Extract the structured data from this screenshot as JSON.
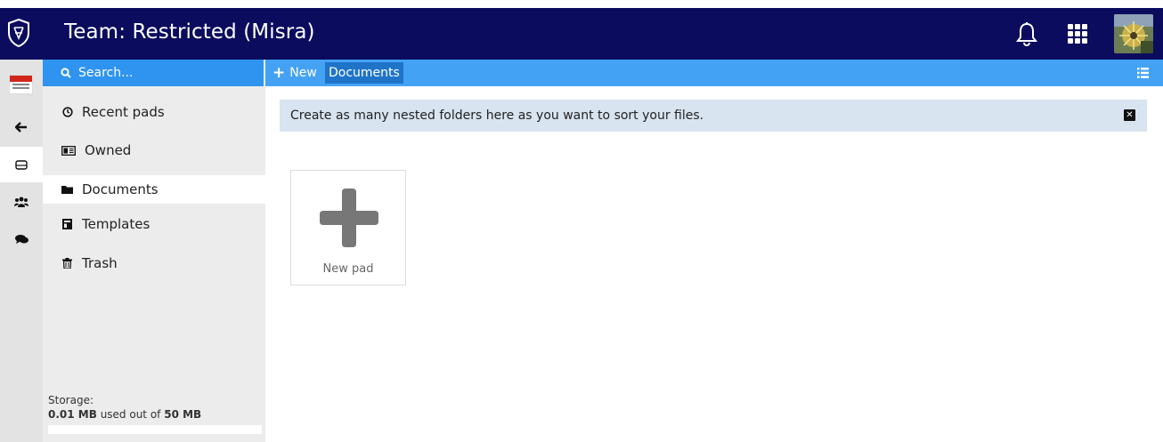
{
  "header": {
    "title": "Team: Restricted (Misra)",
    "logo_icon": "shield-logo-icon",
    "notification_icon": "bell-icon",
    "apps_icon": "grid-icon",
    "avatar_icon": "user-avatar"
  },
  "rail": {
    "items": [
      "restricted-badge-icon",
      "back-arrow-icon",
      "drive-icon",
      "members-icon",
      "chat-icon"
    ]
  },
  "sidebar": {
    "search_placeholder": "Search...",
    "items": [
      {
        "label": "Recent pads",
        "icon": "clock-icon"
      },
      {
        "label": "Owned",
        "icon": "id-card-icon"
      },
      {
        "label": "Documents",
        "icon": "folder-icon",
        "active": true
      },
      {
        "label": "Templates",
        "icon": "template-icon"
      },
      {
        "label": "Trash",
        "icon": "trash-icon"
      }
    ],
    "storage": {
      "heading": "Storage:",
      "used": "0.01 MB",
      "mid": " used out of ",
      "total": "50 MB",
      "fraction": 0.0002
    }
  },
  "toolbar": {
    "new_label": "New",
    "breadcrumb": "Documents"
  },
  "info_banner": {
    "text": "Create as many nested folders here as you want to sort your files."
  },
  "tiles": [
    {
      "label": "New pad"
    }
  ],
  "colors": {
    "topbar": "#0b0c5e",
    "accent": "#2e94f0",
    "toolbar": "#44a2f4",
    "crumb": "#1f74c8"
  }
}
